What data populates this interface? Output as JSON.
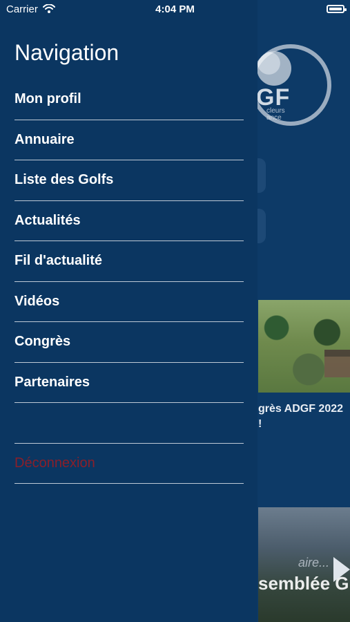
{
  "status_bar": {
    "carrier": "Carrier",
    "time": "4:04 PM"
  },
  "drawer": {
    "title": "Navigation",
    "items": [
      {
        "label": "Mon profil"
      },
      {
        "label": "Annuaire"
      },
      {
        "label": "Liste des Golfs"
      },
      {
        "label": "Actualités"
      },
      {
        "label": "Fil d'actualité"
      },
      {
        "label": "Vidéos"
      },
      {
        "label": "Congrès"
      },
      {
        "label": "Partenaires"
      },
      {
        "label": ""
      },
      {
        "label": "Déconnexion"
      }
    ]
  },
  "background": {
    "logo_text": "GF",
    "logo_sub_line1": "cleurs",
    "logo_sub_line2": "ance",
    "news_title_line1": "grès ADGF 2022",
    "news_title_line2": "!",
    "video_text_line1": "aire...",
    "video_text_line2": "semblée G"
  },
  "colors": {
    "drawer_bg": "#0b3661",
    "app_bg": "#0d3a67",
    "divider": "#bfcad6",
    "logout": "#8a1f2a"
  }
}
